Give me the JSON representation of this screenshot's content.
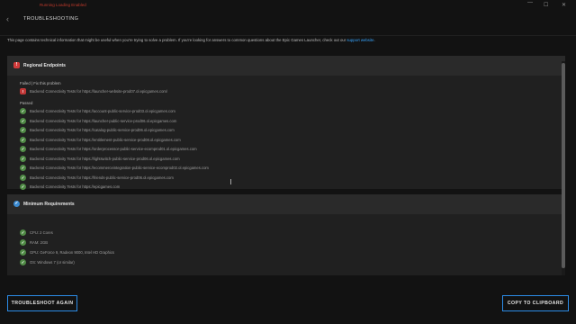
{
  "debug_text": "Running Loading Enabled",
  "header": {
    "title": "TROUBLESHOOTING",
    "back_glyph": "‹"
  },
  "window": {
    "minimize": "—",
    "maximize": "☐",
    "close": "✕"
  },
  "intro": {
    "text": "This page contains technical information that might be useful when you're trying to solve a problem. If you're looking for answers to common questions about the Epic Games Launcher, check out our ",
    "link": "support website",
    "suffix": "."
  },
  "sections": [
    {
      "title": "Regional Endpoints",
      "status": "error",
      "failed_label": "Failed | Fix this problem",
      "failed": [
        "Backend Connectivity Tests for https://launcher-website-prod07.ol.epicgames.com/"
      ],
      "passed_label": "Passed",
      "passed": [
        "Backend Connectivity Tests for https://account-public-service-prod03.ol.epicgames.com",
        "Backend Connectivity Tests for https://launcher-public-service-prod06.ol.epicgames.com",
        "Backend Connectivity Tests for https://catalog-public-service-prod06.ol.epicgames.com",
        "Backend Connectivity Tests for https://entitlement-public-service-prod08.ol.epicgames.com",
        "Backend Connectivity Tests for https://orderprocessor-public-service-ecomprod01.ol.epicgames.com",
        "Backend Connectivity Tests for https://lightswitch-public-service-prod06.ol.epicgames.com",
        "Backend Connectivity Tests for https://ecommerceintegration-public-service-ecomprod02.ol.epicgames.com",
        "Backend Connectivity Tests for https://friends-public-service-prod06.ol.epicgames.com",
        "Backend Connectivity Tests for https://epicgames.com"
      ]
    },
    {
      "title": "Minimum Requirements",
      "status": "ok",
      "items": [
        "CPU: 2 Cores",
        "RAM: 2GB",
        "GPU: GeForce 9, Radeon 9000, Intel HD Graphics",
        "OS: Windows 7 (or similar)"
      ]
    }
  ],
  "buttons": {
    "troubleshoot": "TROUBLESHOOT AGAIN",
    "copy": "COPY TO CLIPBOARD"
  }
}
